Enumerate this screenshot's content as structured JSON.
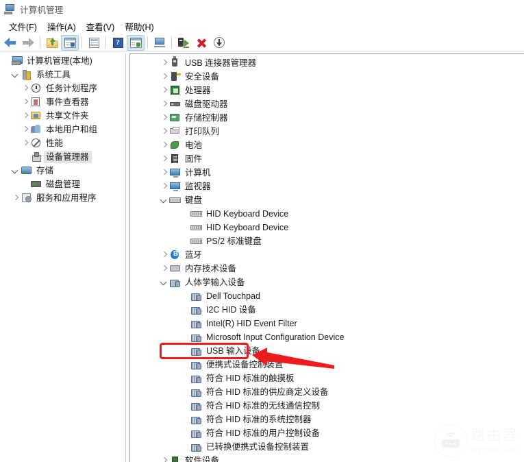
{
  "window": {
    "title": "计算机管理",
    "icon": "computer-management-icon"
  },
  "menubar": {
    "items": [
      {
        "label": "文件(F)",
        "name": "menu-file"
      },
      {
        "label": "操作(A)",
        "name": "menu-action"
      },
      {
        "label": "查看(V)",
        "name": "menu-view"
      },
      {
        "label": "帮助(H)",
        "name": "menu-help"
      }
    ]
  },
  "toolbar": {
    "buttons": [
      {
        "icon": "back-arrow-icon",
        "label": "后退",
        "active": false
      },
      {
        "icon": "forward-arrow-icon",
        "label": "前进",
        "active": false
      },
      {
        "icon": "up-folder-icon",
        "label": "向上一级",
        "active": false
      },
      {
        "icon": "show-console-tree-icon",
        "label": "显示/隐藏控制台树",
        "active": true
      },
      {
        "icon": "properties-icon",
        "label": "属性",
        "active": false
      },
      {
        "icon": "help-icon",
        "label": "帮助",
        "active": false
      },
      {
        "icon": "show-action-pane-icon",
        "label": "显示/隐藏操作窗格",
        "active": true
      },
      {
        "icon": "monitor-icon",
        "label": "扫描",
        "active": false
      },
      {
        "icon": "update-driver-icon",
        "label": "更新驱动程序",
        "active": false
      },
      {
        "icon": "uninstall-device-icon",
        "label": "卸载设备",
        "active": false
      },
      {
        "icon": "scan-hardware-changes-icon",
        "label": "扫描检测硬件改动",
        "active": false
      }
    ]
  },
  "console_tree": {
    "items": [
      {
        "label": "计算机管理(本地)",
        "indent": 0,
        "chev": "none",
        "icon": "computer-management-icon",
        "selected": false
      },
      {
        "label": "系统工具",
        "indent": 1,
        "chev": "open",
        "icon": "system-tools-icon",
        "selected": false
      },
      {
        "label": "任务计划程序",
        "indent": 2,
        "chev": "closed",
        "icon": "task-scheduler-icon",
        "selected": false
      },
      {
        "label": "事件查看器",
        "indent": 2,
        "chev": "closed",
        "icon": "event-viewer-icon",
        "selected": false
      },
      {
        "label": "共享文件夹",
        "indent": 2,
        "chev": "closed",
        "icon": "shared-folders-icon",
        "selected": false
      },
      {
        "label": "本地用户和组",
        "indent": 2,
        "chev": "closed",
        "icon": "local-users-groups-icon",
        "selected": false
      },
      {
        "label": "性能",
        "indent": 2,
        "chev": "closed",
        "icon": "performance-icon",
        "selected": false
      },
      {
        "label": "设备管理器",
        "indent": 2,
        "chev": "none",
        "icon": "device-manager-icon",
        "selected": true
      },
      {
        "label": "存储",
        "indent": 1,
        "chev": "open",
        "icon": "storage-icon",
        "selected": false
      },
      {
        "label": "磁盘管理",
        "indent": 2,
        "chev": "none",
        "icon": "disk-management-icon",
        "selected": false
      },
      {
        "label": "服务和应用程序",
        "indent": 1,
        "chev": "closed",
        "icon": "services-applications-icon",
        "selected": false
      }
    ]
  },
  "device_tree": {
    "items": [
      {
        "label": "USB 连接器管理器",
        "indent": 1,
        "chev": "closed",
        "icon": "usb-icon"
      },
      {
        "label": "安全设备",
        "indent": 1,
        "chev": "closed",
        "icon": "security-device-icon"
      },
      {
        "label": "处理器",
        "indent": 1,
        "chev": "closed",
        "icon": "processor-icon"
      },
      {
        "label": "磁盘驱动器",
        "indent": 1,
        "chev": "closed",
        "icon": "disk-drive-icon"
      },
      {
        "label": "存储控制器",
        "indent": 1,
        "chev": "closed",
        "icon": "storage-controller-icon"
      },
      {
        "label": "打印队列",
        "indent": 1,
        "chev": "closed",
        "icon": "print-queue-icon"
      },
      {
        "label": "电池",
        "indent": 1,
        "chev": "closed",
        "icon": "battery-icon"
      },
      {
        "label": "固件",
        "indent": 1,
        "chev": "closed",
        "icon": "firmware-icon"
      },
      {
        "label": "计算机",
        "indent": 1,
        "chev": "closed",
        "icon": "computer-icon"
      },
      {
        "label": "监视器",
        "indent": 1,
        "chev": "closed",
        "icon": "monitor-device-icon"
      },
      {
        "label": "键盘",
        "indent": 1,
        "chev": "open",
        "icon": "keyboard-icon"
      },
      {
        "label": "HID Keyboard Device",
        "indent": 2,
        "chev": "none",
        "icon": "keyboard-icon"
      },
      {
        "label": "HID Keyboard Device",
        "indent": 2,
        "chev": "none",
        "icon": "keyboard-icon"
      },
      {
        "label": "PS/2 标准键盘",
        "indent": 2,
        "chev": "none",
        "icon": "keyboard-icon"
      },
      {
        "label": "蓝牙",
        "indent": 1,
        "chev": "closed",
        "icon": "bluetooth-icon"
      },
      {
        "label": "内存技术设备",
        "indent": 1,
        "chev": "closed",
        "icon": "memory-device-icon"
      },
      {
        "label": "人体学输入设备",
        "indent": 1,
        "chev": "open",
        "icon": "hid-icon"
      },
      {
        "label": "Dell Touchpad",
        "indent": 2,
        "chev": "none",
        "icon": "hid-icon"
      },
      {
        "label": "I2C HID 设备",
        "indent": 2,
        "chev": "none",
        "icon": "hid-icon"
      },
      {
        "label": "Intel(R) HID Event Filter",
        "indent": 2,
        "chev": "none",
        "icon": "hid-icon"
      },
      {
        "label": "Microsoft Input Configuration Device",
        "indent": 2,
        "chev": "none",
        "icon": "hid-icon"
      },
      {
        "label": "USB 输入设备",
        "indent": 2,
        "chev": "none",
        "icon": "hid-icon",
        "highlighted": true
      },
      {
        "label": "便携式设备控制装置",
        "indent": 2,
        "chev": "none",
        "icon": "hid-icon"
      },
      {
        "label": "符合 HID 标准的触摸板",
        "indent": 2,
        "chev": "none",
        "icon": "hid-icon"
      },
      {
        "label": "符合 HID 标准的供应商定义设备",
        "indent": 2,
        "chev": "none",
        "icon": "hid-icon"
      },
      {
        "label": "符合 HID 标准的无线通信控制",
        "indent": 2,
        "chev": "none",
        "icon": "hid-icon"
      },
      {
        "label": "符合 HID 标准的系统控制器",
        "indent": 2,
        "chev": "none",
        "icon": "hid-icon"
      },
      {
        "label": "符合 HID 标准的用户控制设备",
        "indent": 2,
        "chev": "none",
        "icon": "hid-icon"
      },
      {
        "label": "已转换便携式设备控制装置",
        "indent": 2,
        "chev": "none",
        "icon": "hid-icon"
      },
      {
        "label": "软件设备",
        "indent": 1,
        "chev": "closed",
        "icon": "software-device-icon"
      }
    ]
  },
  "annotations": {
    "highlight_box": {
      "color": "#ee1c1c",
      "target": "USB 输入设备"
    },
    "pointer_arrow": {
      "color": "#ee1c1c",
      "direction": "left"
    }
  },
  "watermark": {
    "cn": "路由器",
    "en": "luyouqi.com",
    "icon": "router-icon"
  }
}
